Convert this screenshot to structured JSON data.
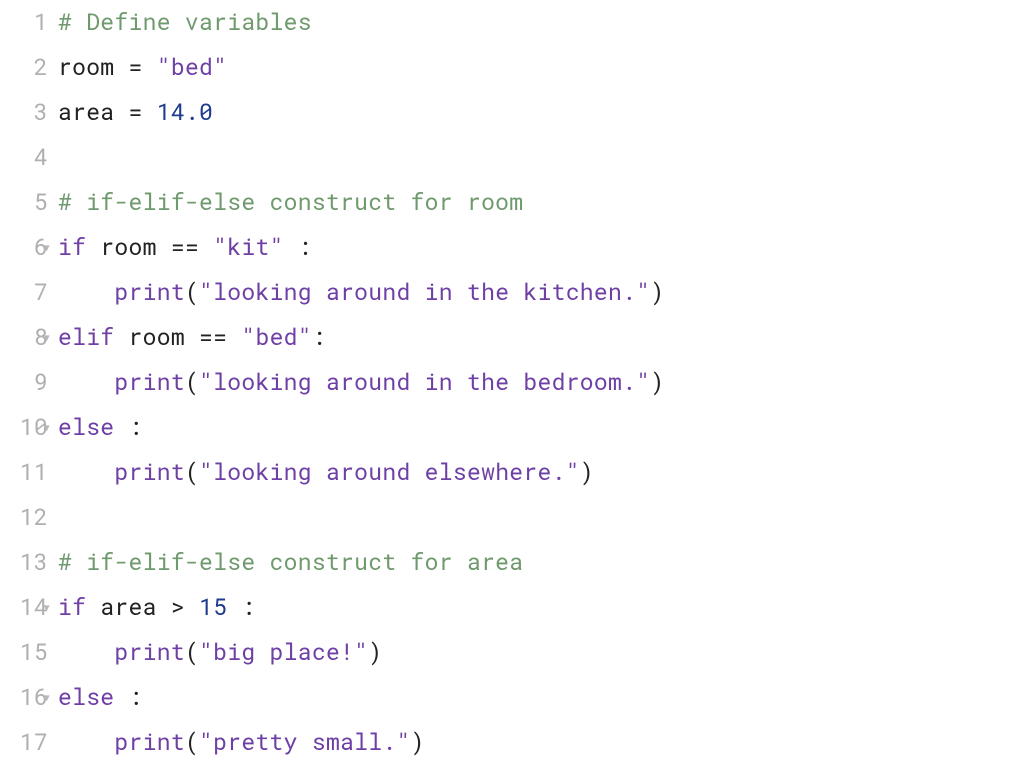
{
  "lines": [
    {
      "num": "1",
      "fold": false,
      "tokens": [
        [
          "comment",
          "# Define variables"
        ]
      ]
    },
    {
      "num": "2",
      "fold": false,
      "tokens": [
        [
          "ident",
          "room"
        ],
        [
          "op",
          " = "
        ],
        [
          "str",
          "\"bed\""
        ]
      ]
    },
    {
      "num": "3",
      "fold": false,
      "tokens": [
        [
          "ident",
          "area"
        ],
        [
          "op",
          " = "
        ],
        [
          "num",
          "14.0"
        ]
      ]
    },
    {
      "num": "4",
      "fold": false,
      "tokens": []
    },
    {
      "num": "5",
      "fold": false,
      "tokens": [
        [
          "comment",
          "# if-elif-else construct for room"
        ]
      ]
    },
    {
      "num": "6",
      "fold": true,
      "tokens": [
        [
          "kw",
          "if"
        ],
        [
          "ident",
          " room "
        ],
        [
          "op",
          "=="
        ],
        [
          "str",
          " \"kit\" "
        ],
        [
          "punct",
          ":"
        ]
      ]
    },
    {
      "num": "7",
      "fold": false,
      "tokens": [
        [
          "ident",
          "    "
        ],
        [
          "func",
          "print"
        ],
        [
          "punct",
          "("
        ],
        [
          "str",
          "\"looking around in the kitchen.\""
        ],
        [
          "punct",
          ")"
        ]
      ]
    },
    {
      "num": "8",
      "fold": true,
      "tokens": [
        [
          "kw",
          "elif"
        ],
        [
          "ident",
          " room "
        ],
        [
          "op",
          "=="
        ],
        [
          "str",
          " \"bed\""
        ],
        [
          "punct",
          ":"
        ]
      ]
    },
    {
      "num": "9",
      "fold": false,
      "tokens": [
        [
          "ident",
          "    "
        ],
        [
          "func",
          "print"
        ],
        [
          "punct",
          "("
        ],
        [
          "str",
          "\"looking around in the bedroom.\""
        ],
        [
          "punct",
          ")"
        ]
      ]
    },
    {
      "num": "10",
      "fold": true,
      "tokens": [
        [
          "kw",
          "else "
        ],
        [
          "punct",
          ":"
        ]
      ]
    },
    {
      "num": "11",
      "fold": false,
      "tokens": [
        [
          "ident",
          "    "
        ],
        [
          "func",
          "print"
        ],
        [
          "punct",
          "("
        ],
        [
          "str",
          "\"looking around elsewhere.\""
        ],
        [
          "punct",
          ")"
        ]
      ]
    },
    {
      "num": "12",
      "fold": false,
      "tokens": []
    },
    {
      "num": "13",
      "fold": false,
      "tokens": [
        [
          "comment",
          "# if-elif-else construct for area"
        ]
      ]
    },
    {
      "num": "14",
      "fold": true,
      "tokens": [
        [
          "kw",
          "if"
        ],
        [
          "ident",
          " area "
        ],
        [
          "op",
          ">"
        ],
        [
          "num",
          " 15 "
        ],
        [
          "punct",
          ":"
        ]
      ]
    },
    {
      "num": "15",
      "fold": false,
      "tokens": [
        [
          "ident",
          "    "
        ],
        [
          "func",
          "print"
        ],
        [
          "punct",
          "("
        ],
        [
          "str",
          "\"big place!\""
        ],
        [
          "punct",
          ")"
        ]
      ]
    },
    {
      "num": "16",
      "fold": true,
      "tokens": [
        [
          "kw",
          "else "
        ],
        [
          "punct",
          ":"
        ]
      ]
    },
    {
      "num": "17",
      "fold": false,
      "tokens": [
        [
          "ident",
          "    "
        ],
        [
          "func",
          "print"
        ],
        [
          "punct",
          "("
        ],
        [
          "str",
          "\"pretty small.\""
        ],
        [
          "punct",
          ")"
        ]
      ]
    }
  ],
  "fold_marker": "▼"
}
